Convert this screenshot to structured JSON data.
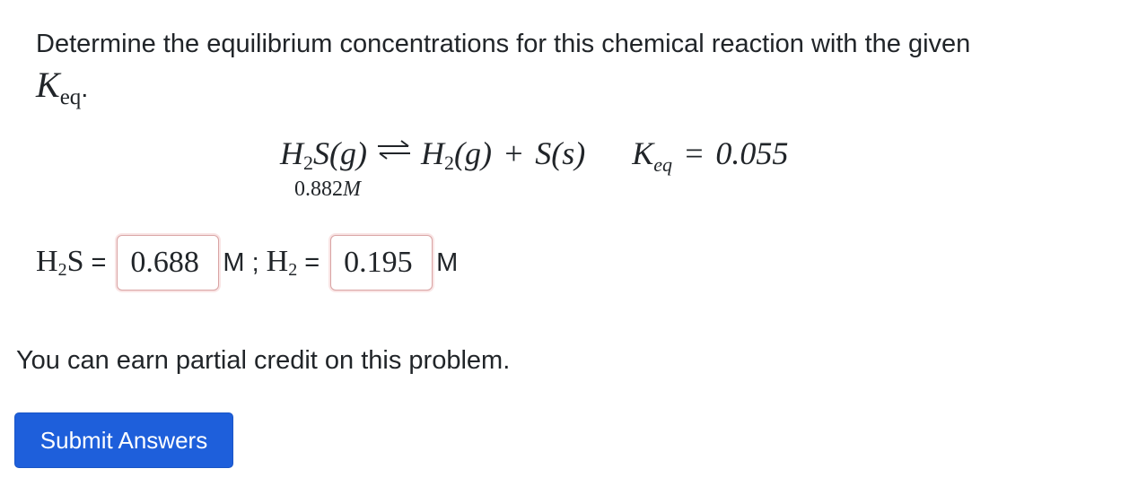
{
  "prompt": {
    "text": "Determine the equilibrium concentrations for this chemical reaction with the given",
    "keq_symbol": "K",
    "keq_subscript": "eq",
    "end_punct": "."
  },
  "equation": {
    "reactant_base": "H",
    "reactant_sub": "2",
    "reactant_rest": "S(g)",
    "product1_base": "H",
    "product1_sub": "2",
    "product1_rest": "(g)",
    "plus": "+",
    "product2": "S(s)",
    "keq_symbol": "K",
    "keq_subscript": "eq",
    "equals": "=",
    "keq_value": "0.055",
    "initial_concentration": "0.882",
    "initial_unit": "M"
  },
  "answers": {
    "h2s_label_base": "H",
    "h2s_label_sub": "2",
    "h2s_label_rest": "S",
    "equals": "=",
    "h2s_value": "0.688",
    "unit": "M",
    "separator": ";",
    "h2_label_base": "H",
    "h2_label_sub": "2",
    "h2_value": "0.195"
  },
  "partial_credit_text": "You can earn partial credit on this problem.",
  "submit_label": "Submit Answers",
  "colors": {
    "submit_bg": "#1e5fdb",
    "answer_border": "#d9a3a3",
    "text": "#212529"
  }
}
